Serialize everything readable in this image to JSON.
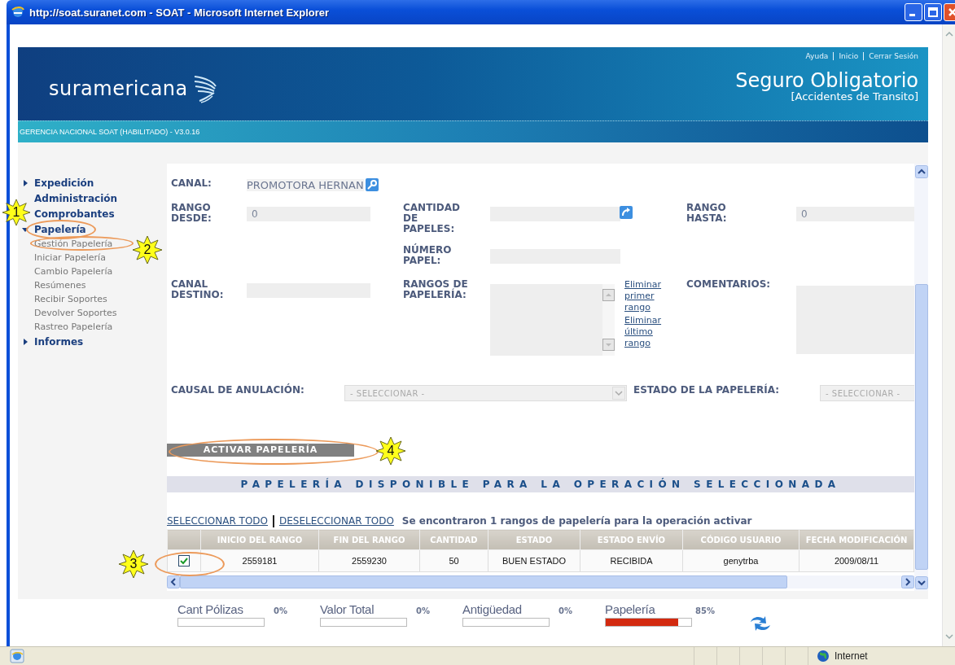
{
  "window": {
    "title": "http://soat.suranet.com - SOAT - Microsoft Internet Explorer"
  },
  "header": {
    "logo": "suramericana",
    "links": [
      "Ayuda",
      "Inicio",
      "Cerrar Sesión"
    ],
    "product_title": "Seguro Obligatorio",
    "product_subtitle": "[Accidentes de Transito]",
    "subtitle_bar": "GERENCIA NACIONAL SOAT (HABILITADO) - V3.0.16"
  },
  "sidebar": {
    "items": [
      {
        "label": "Expedición",
        "expanded": false
      },
      {
        "label": "Administración"
      },
      {
        "label": "Comprobantes"
      },
      {
        "label": "Papelería",
        "expanded": true,
        "children": [
          "Gestión Papelería",
          "Iniciar Papelería",
          "Cambio Papelería",
          "Resúmenes",
          "Recibir Soportes",
          "Devolver Soportes",
          "Rastreo Papelería"
        ]
      },
      {
        "label": "Informes",
        "expanded": false
      }
    ]
  },
  "form": {
    "canal": {
      "label": "CANAL:",
      "value": "PROMOTORA HERNAN"
    },
    "rango_desde": {
      "label": "RANGO DESDE:",
      "value": "0"
    },
    "cantidad_de_papeles": {
      "label": "CANTIDAD DE PAPELES:"
    },
    "rango_hasta": {
      "label": "RANGO HASTA:",
      "value": "0"
    },
    "numero_papel": {
      "label": "NÚMERO PAPEL:"
    },
    "canal_destino": {
      "label": "CANAL DESTINO:"
    },
    "rangos_de_papeleria": {
      "label": "RANGOS DE PAPELERÍA:",
      "links": [
        "Eliminar primer rango",
        "Eliminar último rango"
      ]
    },
    "comentarios": {
      "label": "COMENTARIOS:"
    },
    "causal_de_anulacion": {
      "label": "CAUSAL DE ANULACIÓN:",
      "value": "- SELECCIONAR -"
    },
    "estado_de_la_papeleria": {
      "label": "ESTADO DE LA PAPELERÍA:",
      "value": "- SELECCIONAR -"
    }
  },
  "action_button": "ACTIVAR PAPELERÍA",
  "section_title": "PAPELERÍA DISPONIBLE PARA LA OPERACIÓN SELECCIONADA",
  "results": {
    "links": [
      "SELECCIONAR TODO",
      "DESELECCIONAR TODO"
    ],
    "message": "Se encontraron 1 rangos de papelería para la operación activar"
  },
  "table": {
    "columns": [
      "INICIO DEL RANGO",
      "FIN DEL RANGO",
      "CANTIDAD",
      "ESTADO",
      "ESTADO ENVÍO",
      "CÓDIGO USUARIO",
      "FECHA MODIFICACIÓN"
    ],
    "rows": [
      {
        "checked": true,
        "cells": [
          "2559181",
          "2559230",
          "50",
          "BUEN ESTADO",
          "RECIBIDA",
          "genytrba",
          "2009/08/11"
        ]
      }
    ]
  },
  "meters": [
    {
      "label": "Cant Pólizas",
      "reading": "0%",
      "level": 0
    },
    {
      "label": "Valor Total",
      "reading": "0%",
      "level": 0
    },
    {
      "label": "Antigüedad",
      "reading": "0%",
      "level": 0
    },
    {
      "label": "Papelería",
      "reading": "85%",
      "level": 0.85
    }
  ],
  "annotations": [
    {
      "number": "1"
    },
    {
      "number": "2"
    },
    {
      "number": "3"
    },
    {
      "number": "4"
    }
  ],
  "status_bar": {
    "zone": "Internet"
  }
}
